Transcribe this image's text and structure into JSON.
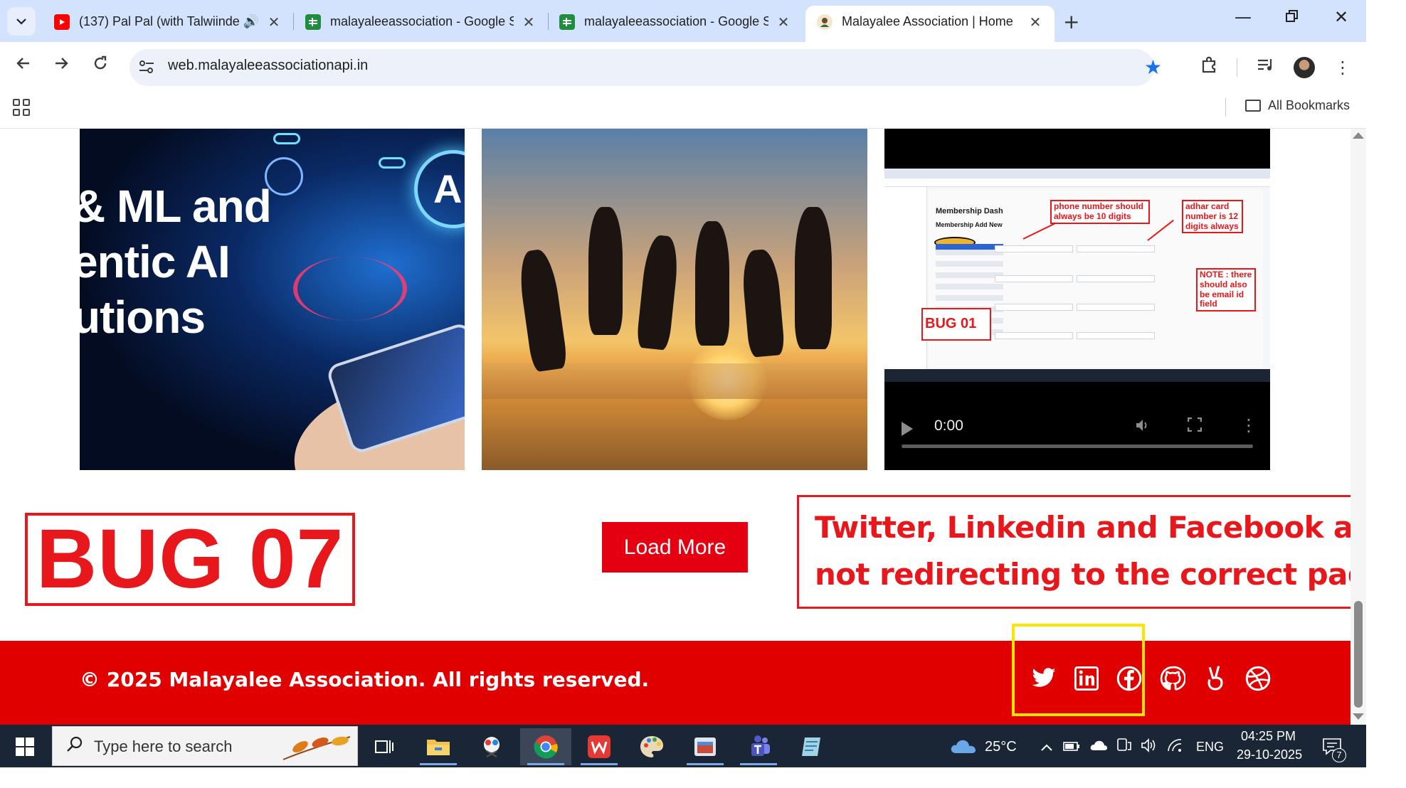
{
  "browser": {
    "tabs": [
      {
        "title": "(137) Pal Pal (with Talwiinder",
        "favicon": "youtube-icon",
        "audio": true
      },
      {
        "title": "malayaleeassociation - Google S",
        "favicon": "sheets-icon"
      },
      {
        "title": "malayaleeassociation - Google S",
        "favicon": "sheets-icon"
      },
      {
        "title": "Malayalee Association | Home",
        "favicon": "site-logo-icon",
        "active": true
      }
    ],
    "url": "web.malayaleeassociationapi.in",
    "bookmarks_label": "All Bookmarks"
  },
  "page": {
    "card1": {
      "lines": [
        "& ML and",
        "entic AI",
        "utions"
      ],
      "badge": "AI"
    },
    "card3": {
      "video_time": "0:00",
      "notes": {
        "phone": "phone number should always be 10 digits",
        "adhar": "adhar card number is 12 digits always",
        "note": "NOTE : there should also be email id field",
        "bug01": "BUG 01",
        "title": "Membership Dash",
        "subtitle": "Membership Add New"
      }
    },
    "bug_label": "BUG 07",
    "load_more": "Load More",
    "bug_note_lines": [
      "Twitter, Linkedin and Facebook are",
      "not redirecting to the correct page."
    ],
    "footer": {
      "copyright": "© 2025 Malayalee Association. All rights reserved.",
      "social": [
        "twitter-icon",
        "linkedin-icon",
        "facebook-icon",
        "github-icon",
        "peace-icon",
        "dribbble-icon"
      ]
    }
  },
  "taskbar": {
    "search_placeholder": "Type here to search",
    "weather": "25°C",
    "language": "ENG",
    "time": "04:25 PM",
    "date": "29-10-2025",
    "notifications": "7"
  },
  "colors": {
    "accent_red": "#e00000",
    "annotation_red": "#e8171c",
    "highlight_yellow": "#ffe400",
    "tab_strip": "#d3e3fd"
  }
}
